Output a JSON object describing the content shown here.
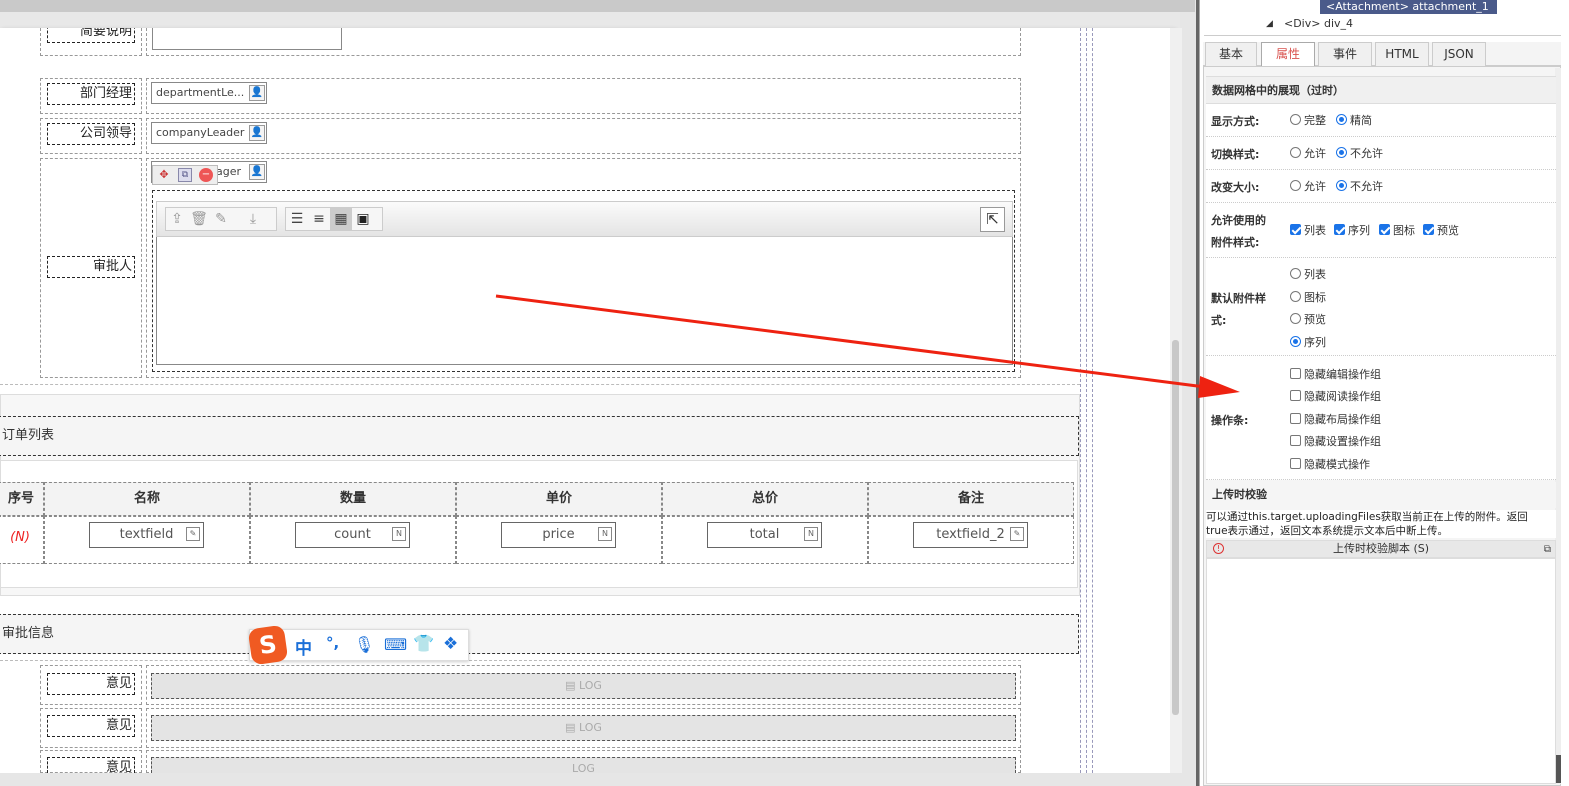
{
  "tree": {
    "selected_node": "<Attachment> attachment_1",
    "div_node": "<Div> div_4"
  },
  "form": {
    "summary_label": "简要说明",
    "dept_manager_label": "部门经理",
    "dept_manager_value": "departmentLe...",
    "company_leader_label": "公司领导",
    "company_leader_value": "companyLeader",
    "approver_label": "审批人",
    "approver_value": "ager",
    "order_section_title": "订单列表",
    "approval_section_title": "审批信息",
    "opinion_label": "意见",
    "log_text": "LOG"
  },
  "order_table": {
    "headers": [
      "序号",
      "名称",
      "数量",
      "单价",
      "总价",
      "备注"
    ],
    "row_index": "(N)",
    "fields": [
      "textfield",
      "count",
      "price",
      "total",
      "textfield_2"
    ]
  },
  "ime": {
    "logo": "S",
    "lang": "中",
    "punct": "°,"
  },
  "panel": {
    "tabs": [
      "基本",
      "属性",
      "事件",
      "HTML",
      "JSON"
    ],
    "active_tab": "属性",
    "section_title": "数据网格中的展现（过时）",
    "display_label": "显示方式:",
    "display_opts": [
      "完整",
      "精简"
    ],
    "switch_label": "切换样式:",
    "resize_label": "改变大小:",
    "allow_opts": [
      "允许",
      "不允许"
    ],
    "allowed_styles_label_1": "允许使用的",
    "allowed_styles_label_2": "附件样式:",
    "styles": [
      "列表",
      "序列",
      "图标",
      "预览"
    ],
    "default_style_label_1": "默认附件样",
    "default_style_label_2": "式:",
    "default_opts": [
      "列表",
      "图标",
      "预览",
      "序列"
    ],
    "toolbar_label": "操作条:",
    "hide_opts": [
      "隐藏编辑操作组",
      "隐藏阅读操作组",
      "隐藏布局操作组",
      "隐藏设置操作组",
      "隐藏模式操作"
    ],
    "upload_check_title": "上传时校验",
    "upload_check_desc_1": "可以通过this.target.uploadingFiles获取当前正在上传的附件。返回",
    "upload_check_desc_2": "true表示通过，返回文本系统提示文本后中断上传。",
    "script_title": "上传时校验脚本 (S)"
  },
  "colors": {
    "accent": "#1a73e8",
    "arrow": "#ee2211",
    "active_tab_text": "#d9534f",
    "ime_logo": "#f05a22"
  }
}
